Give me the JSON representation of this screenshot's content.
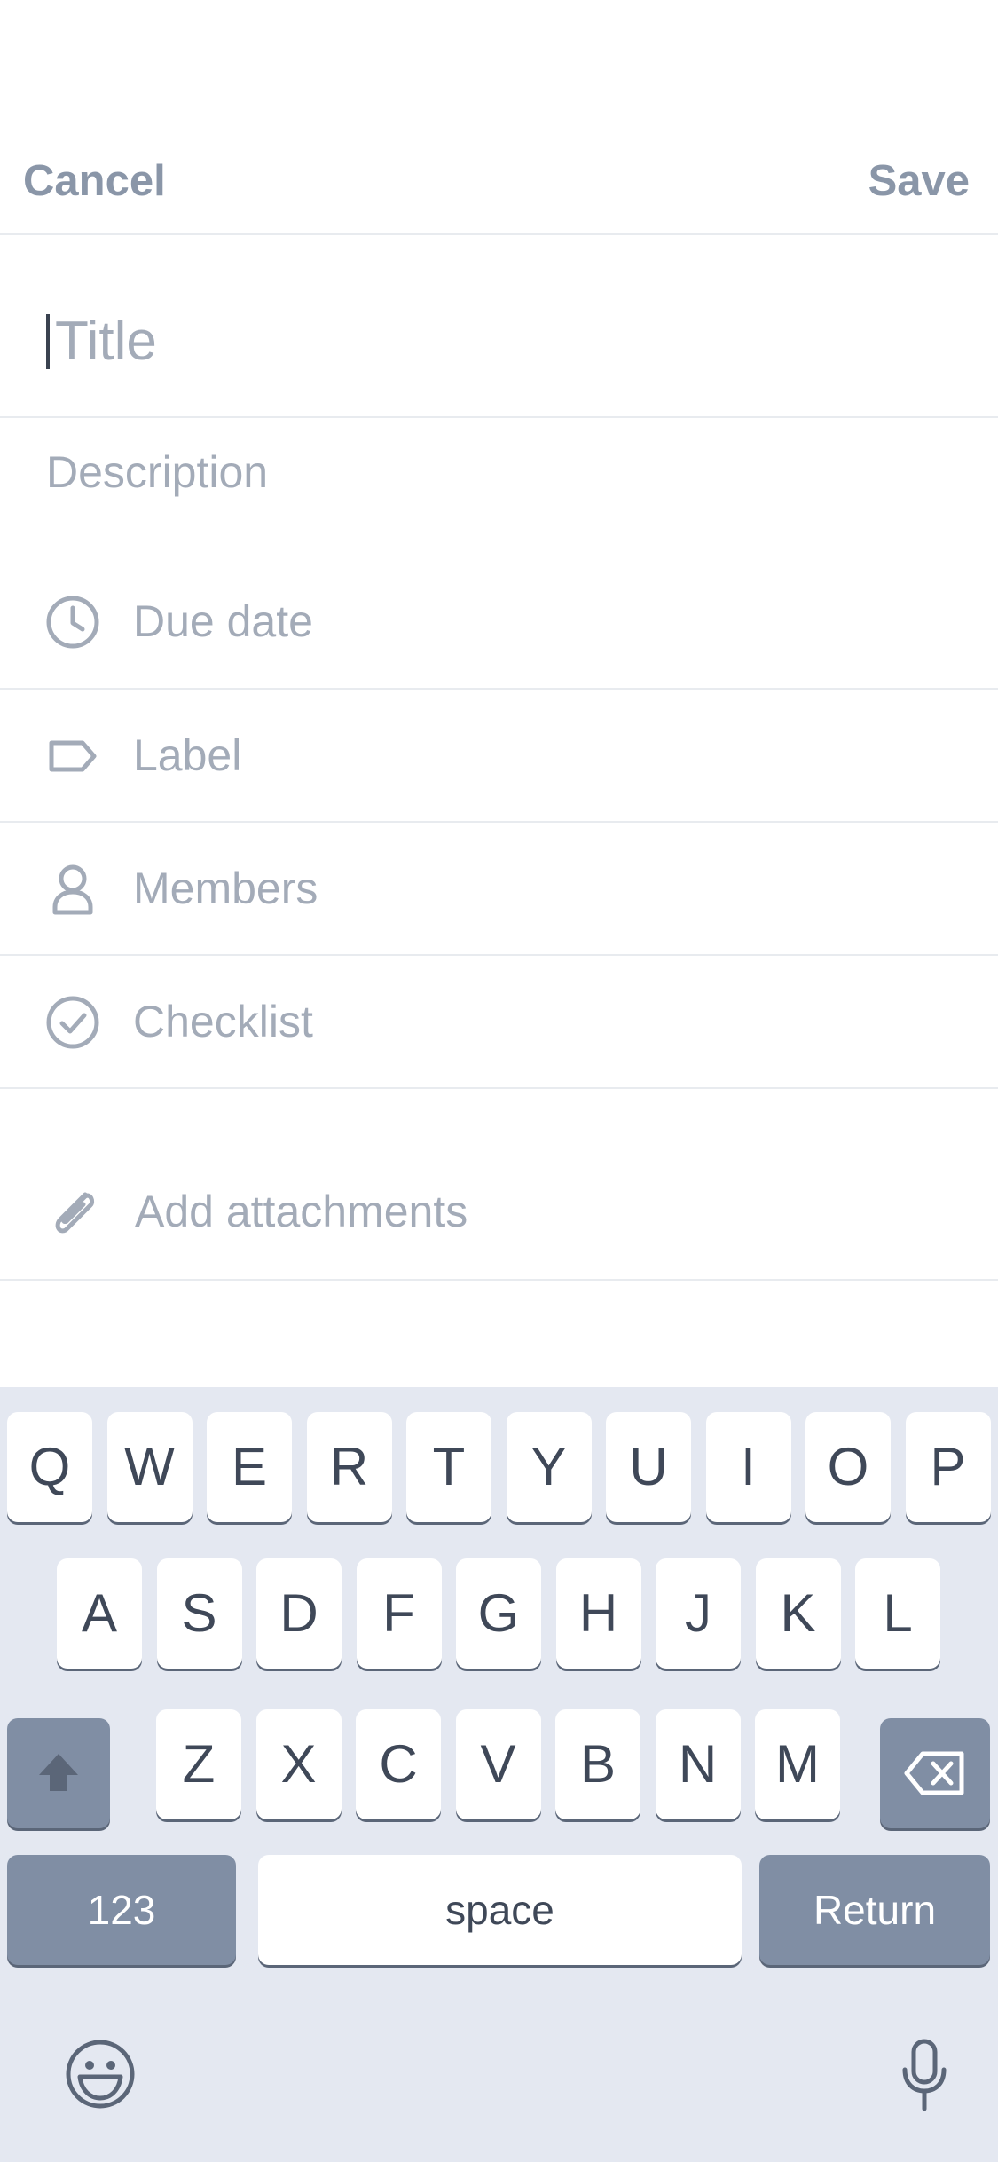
{
  "header": {
    "cancel_label": "Cancel",
    "save_label": "Save"
  },
  "form": {
    "title_placeholder": "Title",
    "description_placeholder": "Description",
    "rows": [
      {
        "label": "Due date",
        "icon": "clock-icon"
      },
      {
        "label": "Label",
        "icon": "tag-icon"
      },
      {
        "label": "Members",
        "icon": "person-icon"
      },
      {
        "label": "Checklist",
        "icon": "check-circle-icon"
      }
    ],
    "attachments_label": "Add attachments",
    "attachments_icon": "paperclip-icon"
  },
  "keyboard": {
    "row1": [
      "Q",
      "W",
      "E",
      "R",
      "T",
      "Y",
      "U",
      "I",
      "O",
      "P"
    ],
    "row2": [
      "A",
      "S",
      "D",
      "F",
      "G",
      "H",
      "J",
      "K",
      "L"
    ],
    "row3": [
      "Z",
      "X",
      "C",
      "V",
      "B",
      "N",
      "M"
    ],
    "numbers_label": "123",
    "space_label": "space",
    "return_label": "Return",
    "shift_icon": "shift-icon",
    "backspace_icon": "backspace-icon",
    "emoji_icon": "emoji-icon",
    "mic_icon": "microphone-icon"
  }
}
